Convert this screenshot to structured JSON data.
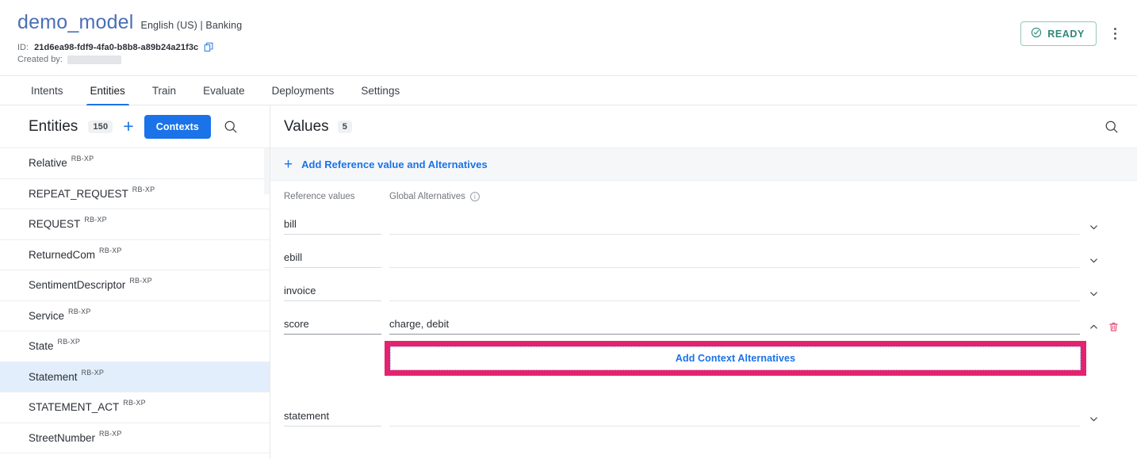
{
  "header": {
    "model_title": "demo_model",
    "model_meta": "English (US) | Banking",
    "id_label": "ID:",
    "id_value": "21d6ea98-fdf9-4fa0-b8b8-a89b24a21f3c",
    "created_by_label": "Created by:",
    "copy_icon": "copy-icon",
    "status_badge": "READY",
    "status_icon": "check-circle-icon",
    "status_color": "#2e8878",
    "kebab_icon": "more-vertical-icon"
  },
  "tabs": [
    {
      "label": "Intents",
      "active": false
    },
    {
      "label": "Entities",
      "active": true
    },
    {
      "label": "Train",
      "active": false
    },
    {
      "label": "Evaluate",
      "active": false
    },
    {
      "label": "Deployments",
      "active": false
    },
    {
      "label": "Settings",
      "active": false
    }
  ],
  "entities_pane": {
    "title": "Entities",
    "count": "150",
    "add_icon": "plus-icon",
    "contexts_button": "Contexts",
    "search_icon": "search-icon",
    "items": [
      {
        "name": "Relative",
        "tag": "RB-XP",
        "selected": false
      },
      {
        "name": "REPEAT_REQUEST",
        "tag": "RB-XP",
        "selected": false
      },
      {
        "name": "REQUEST",
        "tag": "RB-XP",
        "selected": false
      },
      {
        "name": "ReturnedCom",
        "tag": "RB-XP",
        "selected": false
      },
      {
        "name": "SentimentDescriptor",
        "tag": "RB-XP",
        "selected": false
      },
      {
        "name": "Service",
        "tag": "RB-XP",
        "selected": false
      },
      {
        "name": "State",
        "tag": "RB-XP",
        "selected": false
      },
      {
        "name": "Statement",
        "tag": "RB-XP",
        "selected": true
      },
      {
        "name": "STATEMENT_ACT",
        "tag": "RB-XP",
        "selected": false
      },
      {
        "name": "StreetNumber",
        "tag": "RB-XP",
        "selected": false
      }
    ]
  },
  "values_pane": {
    "title": "Values",
    "count": "5",
    "search_icon": "search-icon",
    "add_reference_plus": "plus-icon",
    "add_reference_label": "Add Reference value and Alternatives",
    "column_reference": "Reference values",
    "column_global": "Global Alternatives",
    "column_global_info_icon": "info-icon",
    "rows": [
      {
        "reference": "bill",
        "alternatives": "",
        "expanded": false,
        "chevron": "chevron-down-icon"
      },
      {
        "reference": "ebill",
        "alternatives": "",
        "expanded": false,
        "chevron": "chevron-down-icon"
      },
      {
        "reference": "invoice",
        "alternatives": "",
        "expanded": false,
        "chevron": "chevron-down-icon"
      },
      {
        "reference": "score",
        "alternatives": "charge, debit",
        "expanded": true,
        "chevron": "chevron-up-icon",
        "delete_icon": "trash-icon"
      },
      {
        "reference": "statement",
        "alternatives": "",
        "expanded": false,
        "chevron": "chevron-down-icon"
      }
    ],
    "context_alternatives_button": "Add Context Alternatives",
    "highlight_color": "#e5236d"
  }
}
